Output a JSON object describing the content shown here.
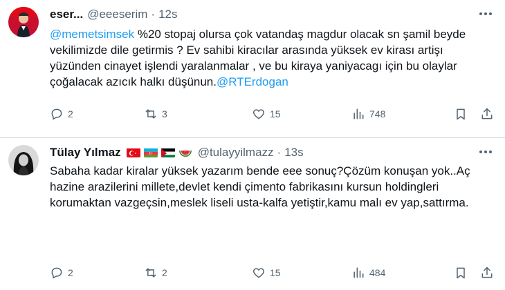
{
  "tweets": [
    {
      "display_name": "eser...",
      "handle": "@eeeserim",
      "separator": "·",
      "time": "12s",
      "text_mention_1": "@memetsimsek",
      "text_body": " %20 stopaj olursa çok vatandaş magdur olacak sn şamil beyde vekilimizde dile getirmis ? Ev sahibi kiracılar arasında yüksek ev kirası artişı yüzünden cinayet işlendi yaralanmalar , ve bu kiraya yaniyacagı için bu olaylar çoğalacak azıcık halkı düşünun.",
      "text_mention_2": "@RTErdogan",
      "replies": "2",
      "reposts": "3",
      "likes": "15",
      "views": "748"
    },
    {
      "display_name": "Tülay Yılmaz",
      "handle": "@tulayyilmazz",
      "separator": "·",
      "time": "13s",
      "text": "Sabaha kadar kiralar yüksek yazarım bende eee sonuç?Çözüm konuşan yok..Aç hazine arazilerini millete,devlet kendi çimento fabrikasını kursun holdingleri korumaktan vazgeçsin,meslek liseli usta-kalfa yetiştir,kamu malı ev yap,sattırma.",
      "replies": "2",
      "reposts": "2",
      "likes": "15",
      "views": "484"
    }
  ],
  "icons": {
    "more": "more-horizontal-icon",
    "reply": "reply-icon",
    "repost": "repost-icon",
    "like": "heart-icon",
    "views": "views-chart-icon",
    "bookmark": "bookmark-icon",
    "share": "share-icon"
  },
  "colors": {
    "text": "#0f1419",
    "muted": "#536471",
    "link": "#1d9bf0",
    "divider": "#cfd9de"
  }
}
